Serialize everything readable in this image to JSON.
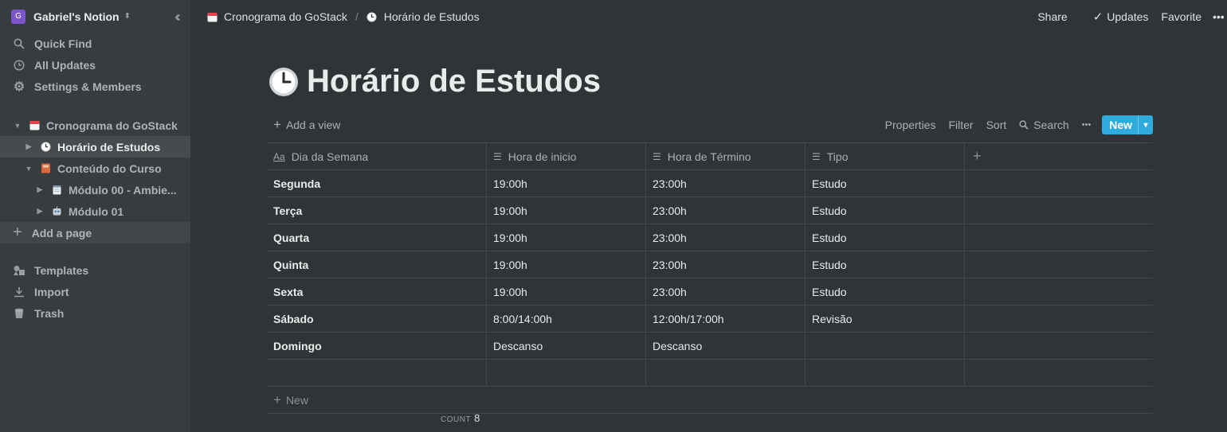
{
  "workspace": {
    "badge": "G",
    "name": "Gabriel's Notion"
  },
  "sidebar": {
    "nav": [
      {
        "label": "Quick Find",
        "icon": "search-icon"
      },
      {
        "label": "All Updates",
        "icon": "clock-icon"
      },
      {
        "label": "Settings & Members",
        "icon": "gear-icon"
      }
    ],
    "pages": [
      {
        "label": "Cronograma do GoStack",
        "icon": "calendar-icon",
        "expanded": true
      },
      {
        "label": "Horário de Estudos",
        "icon": "clock-emoji-icon",
        "expanded": false,
        "active": true
      },
      {
        "label": "Conteúdo do Curso",
        "icon": "book-icon",
        "expanded": true
      },
      {
        "label": "Módulo 00 - Ambie...",
        "icon": "notepad-icon",
        "expanded": false
      },
      {
        "label": "Módulo 01",
        "icon": "robot-icon",
        "expanded": false
      }
    ],
    "add_page": "Add a page",
    "bottom": [
      {
        "label": "Templates",
        "icon": "templates-icon"
      },
      {
        "label": "Import",
        "icon": "import-icon"
      },
      {
        "label": "Trash",
        "icon": "trash-icon"
      }
    ]
  },
  "topbar": {
    "breadcrumb": [
      "Cronograma do GoStack",
      "Horário de Estudos"
    ],
    "separator": "/",
    "share": "Share",
    "updates": "Updates",
    "favorite": "Favorite"
  },
  "page": {
    "title": "Horário de Estudos",
    "emoji": "🕐"
  },
  "toolbar": {
    "add_view": "Add a view",
    "properties": "Properties",
    "filter": "Filter",
    "sort": "Sort",
    "search": "Search",
    "more": "•••",
    "new": "New"
  },
  "table": {
    "columns": [
      {
        "label": "Dia da Semana",
        "icon": "Aa"
      },
      {
        "label": "Hora de inicio",
        "icon": "text-icon"
      },
      {
        "label": "Hora de Término",
        "icon": "text-icon"
      },
      {
        "label": "Tipo",
        "icon": "text-icon"
      }
    ],
    "rows": [
      [
        "Segunda",
        "19:00h",
        "23:00h",
        "Estudo"
      ],
      [
        "Terça",
        "19:00h",
        "23:00h",
        "Estudo"
      ],
      [
        "Quarta",
        "19:00h",
        "23:00h",
        "Estudo"
      ],
      [
        "Quinta",
        "19:00h",
        "23:00h",
        "Estudo"
      ],
      [
        "Sexta",
        "19:00h",
        "23:00h",
        "Estudo"
      ],
      [
        "Sábado",
        "8:00/14:00h",
        "12:00h/17:00h",
        "Revisão"
      ],
      [
        "Domingo",
        "Descanso",
        "Descanso",
        ""
      ],
      [
        "",
        "",
        "",
        ""
      ]
    ],
    "new_row": "New",
    "count_label": "COUNT",
    "count_value": "8"
  }
}
